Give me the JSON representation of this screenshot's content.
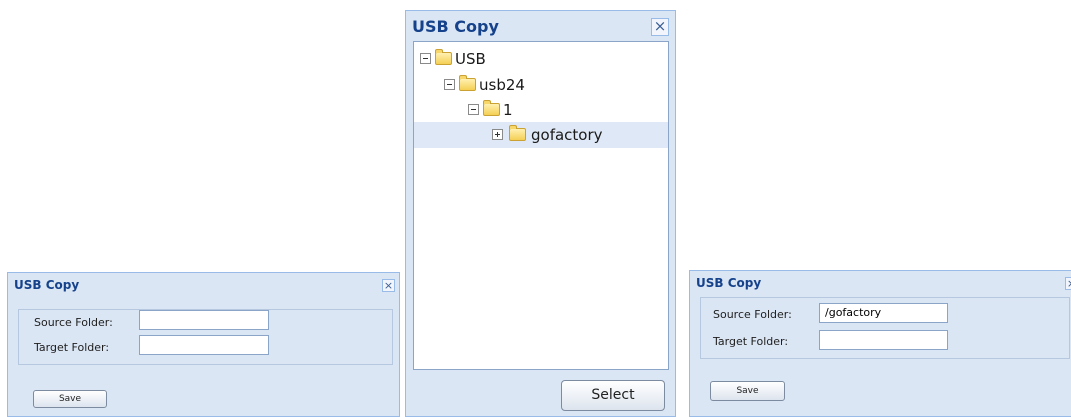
{
  "left_dialog": {
    "title": "USB Copy",
    "close_glyph": "×",
    "source_label": "Source Folder:",
    "source_value": "",
    "target_label": "Target Folder:",
    "target_value": "",
    "save_label": "Save"
  },
  "middle_dialog": {
    "title": "USB Copy",
    "close_glyph": "×",
    "tree": [
      {
        "label": "USB",
        "expanded": true,
        "selected": false,
        "depth": 0
      },
      {
        "label": "usb24",
        "expanded": true,
        "selected": false,
        "depth": 1
      },
      {
        "label": "1",
        "expanded": true,
        "selected": false,
        "depth": 2
      },
      {
        "label": "gofactory",
        "expanded": false,
        "selected": true,
        "depth": 3
      }
    ],
    "select_label": "Select"
  },
  "right_dialog": {
    "title": "USB Copy",
    "close_glyph": "×",
    "source_label": "Source Folder:",
    "source_value": "/gofactory",
    "target_label": "Target Folder:",
    "target_value": "",
    "save_label": "Save"
  },
  "colors": {
    "title_text": "#15428b",
    "window_bg": "#dbe6f4",
    "window_border": "#99bbe8",
    "selected_row": "#dfe8f6"
  }
}
